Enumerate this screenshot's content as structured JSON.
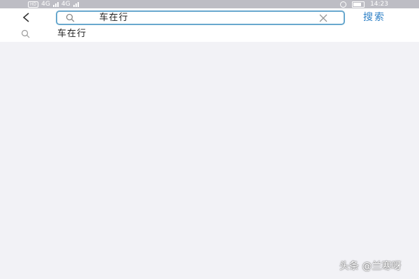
{
  "status_bar": {
    "network_badge": "HD",
    "signal_1": "4G",
    "signal_2": "4G",
    "time": "14:23"
  },
  "header": {
    "back_icon": "chevron-left-icon",
    "search": {
      "value": "车在行",
      "icon": "search-icon",
      "clear_icon": "close-icon"
    },
    "search_button_label": "搜索"
  },
  "suggestions": [
    {
      "text": "车在行",
      "icon": "search-icon"
    }
  ],
  "watermark": "头条 @兰寒呀",
  "colors": {
    "accent": "#2e80c6",
    "search_border": "#68a8ce",
    "background": "#f2f2f6",
    "status_bar": "#bdbdc4"
  }
}
